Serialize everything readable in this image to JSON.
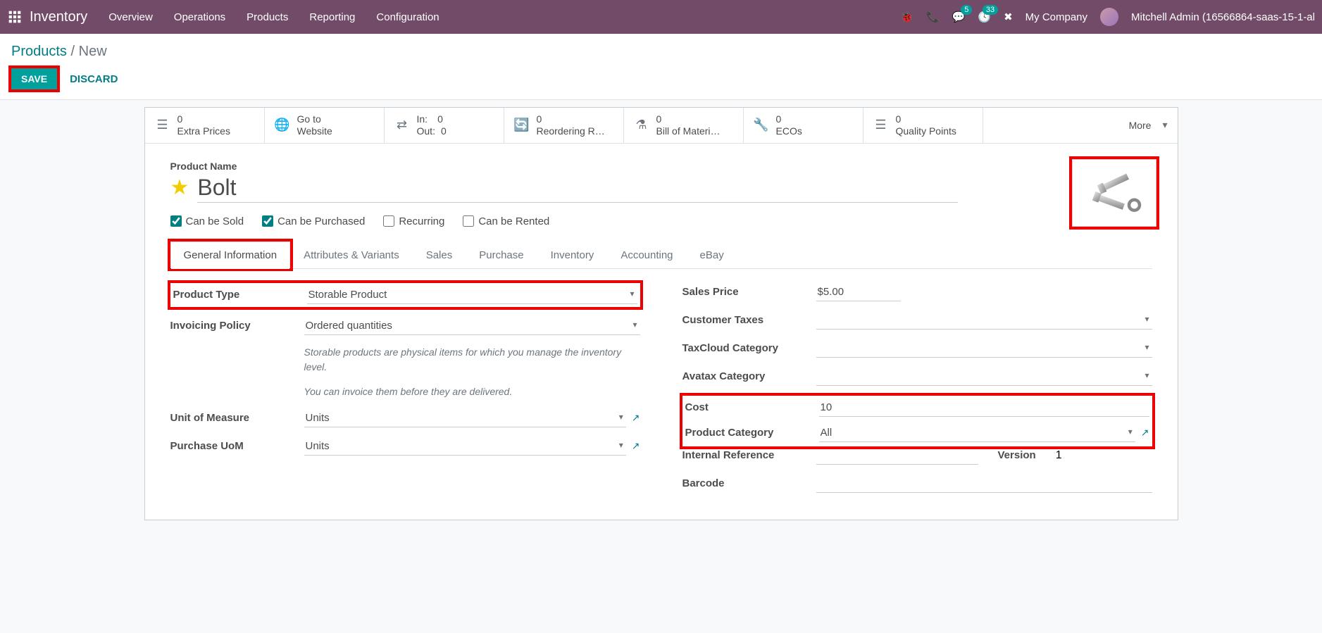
{
  "topnav": {
    "brand": "Inventory",
    "menu": [
      "Overview",
      "Operations",
      "Products",
      "Reporting",
      "Configuration"
    ],
    "chat_count": "5",
    "activity_count": "33",
    "company": "My Company",
    "user": "Mitchell Admin (16566864-saas-15-1-al"
  },
  "breadcrumb": {
    "link": "Products",
    "current": "New"
  },
  "actions": {
    "save": "SAVE",
    "discard": "DISCARD"
  },
  "stat_buttons": [
    {
      "icon": "list",
      "num": "0",
      "lbl": "Extra Prices"
    },
    {
      "icon": "globe",
      "num": "Go to",
      "lbl": "Website"
    },
    {
      "icon": "exchange",
      "num_top": "In:",
      "val_top": "0",
      "num_bot": "Out:",
      "val_bot": "0"
    },
    {
      "icon": "refresh",
      "num": "0",
      "lbl": "Reordering R…"
    },
    {
      "icon": "flask",
      "num": "0",
      "lbl": "Bill of Materi…"
    },
    {
      "icon": "wrench",
      "num": "0",
      "lbl": "ECOs"
    },
    {
      "icon": "list",
      "num": "0",
      "lbl": "Quality Points"
    }
  ],
  "more_label": "More",
  "product": {
    "name_label": "Product Name",
    "name": "Bolt",
    "checks": {
      "sold": "Can be Sold",
      "purchased": "Can be Purchased",
      "recurring": "Recurring",
      "rented": "Can be Rented"
    }
  },
  "tabs": [
    "General Information",
    "Attributes & Variants",
    "Sales",
    "Purchase",
    "Inventory",
    "Accounting",
    "eBay"
  ],
  "form_left": {
    "product_type_lbl": "Product Type",
    "product_type": "Storable Product",
    "invoicing_lbl": "Invoicing Policy",
    "invoicing": "Ordered quantities",
    "help1": "Storable products are physical items for which you manage the inventory level.",
    "help2": "You can invoice them before they are delivered.",
    "uom_lbl": "Unit of Measure",
    "uom": "Units",
    "puom_lbl": "Purchase UoM",
    "puom": "Units"
  },
  "form_right": {
    "sales_price_lbl": "Sales Price",
    "sales_price": "$5.00",
    "cust_tax_lbl": "Customer Taxes",
    "taxcloud_lbl": "TaxCloud Category",
    "avatax_lbl": "Avatax Category",
    "cost_lbl": "Cost",
    "cost": "10",
    "category_lbl": "Product Category",
    "category": "All",
    "intref_lbl": "Internal Reference",
    "version_lbl": "Version",
    "version": "1",
    "barcode_lbl": "Barcode"
  }
}
